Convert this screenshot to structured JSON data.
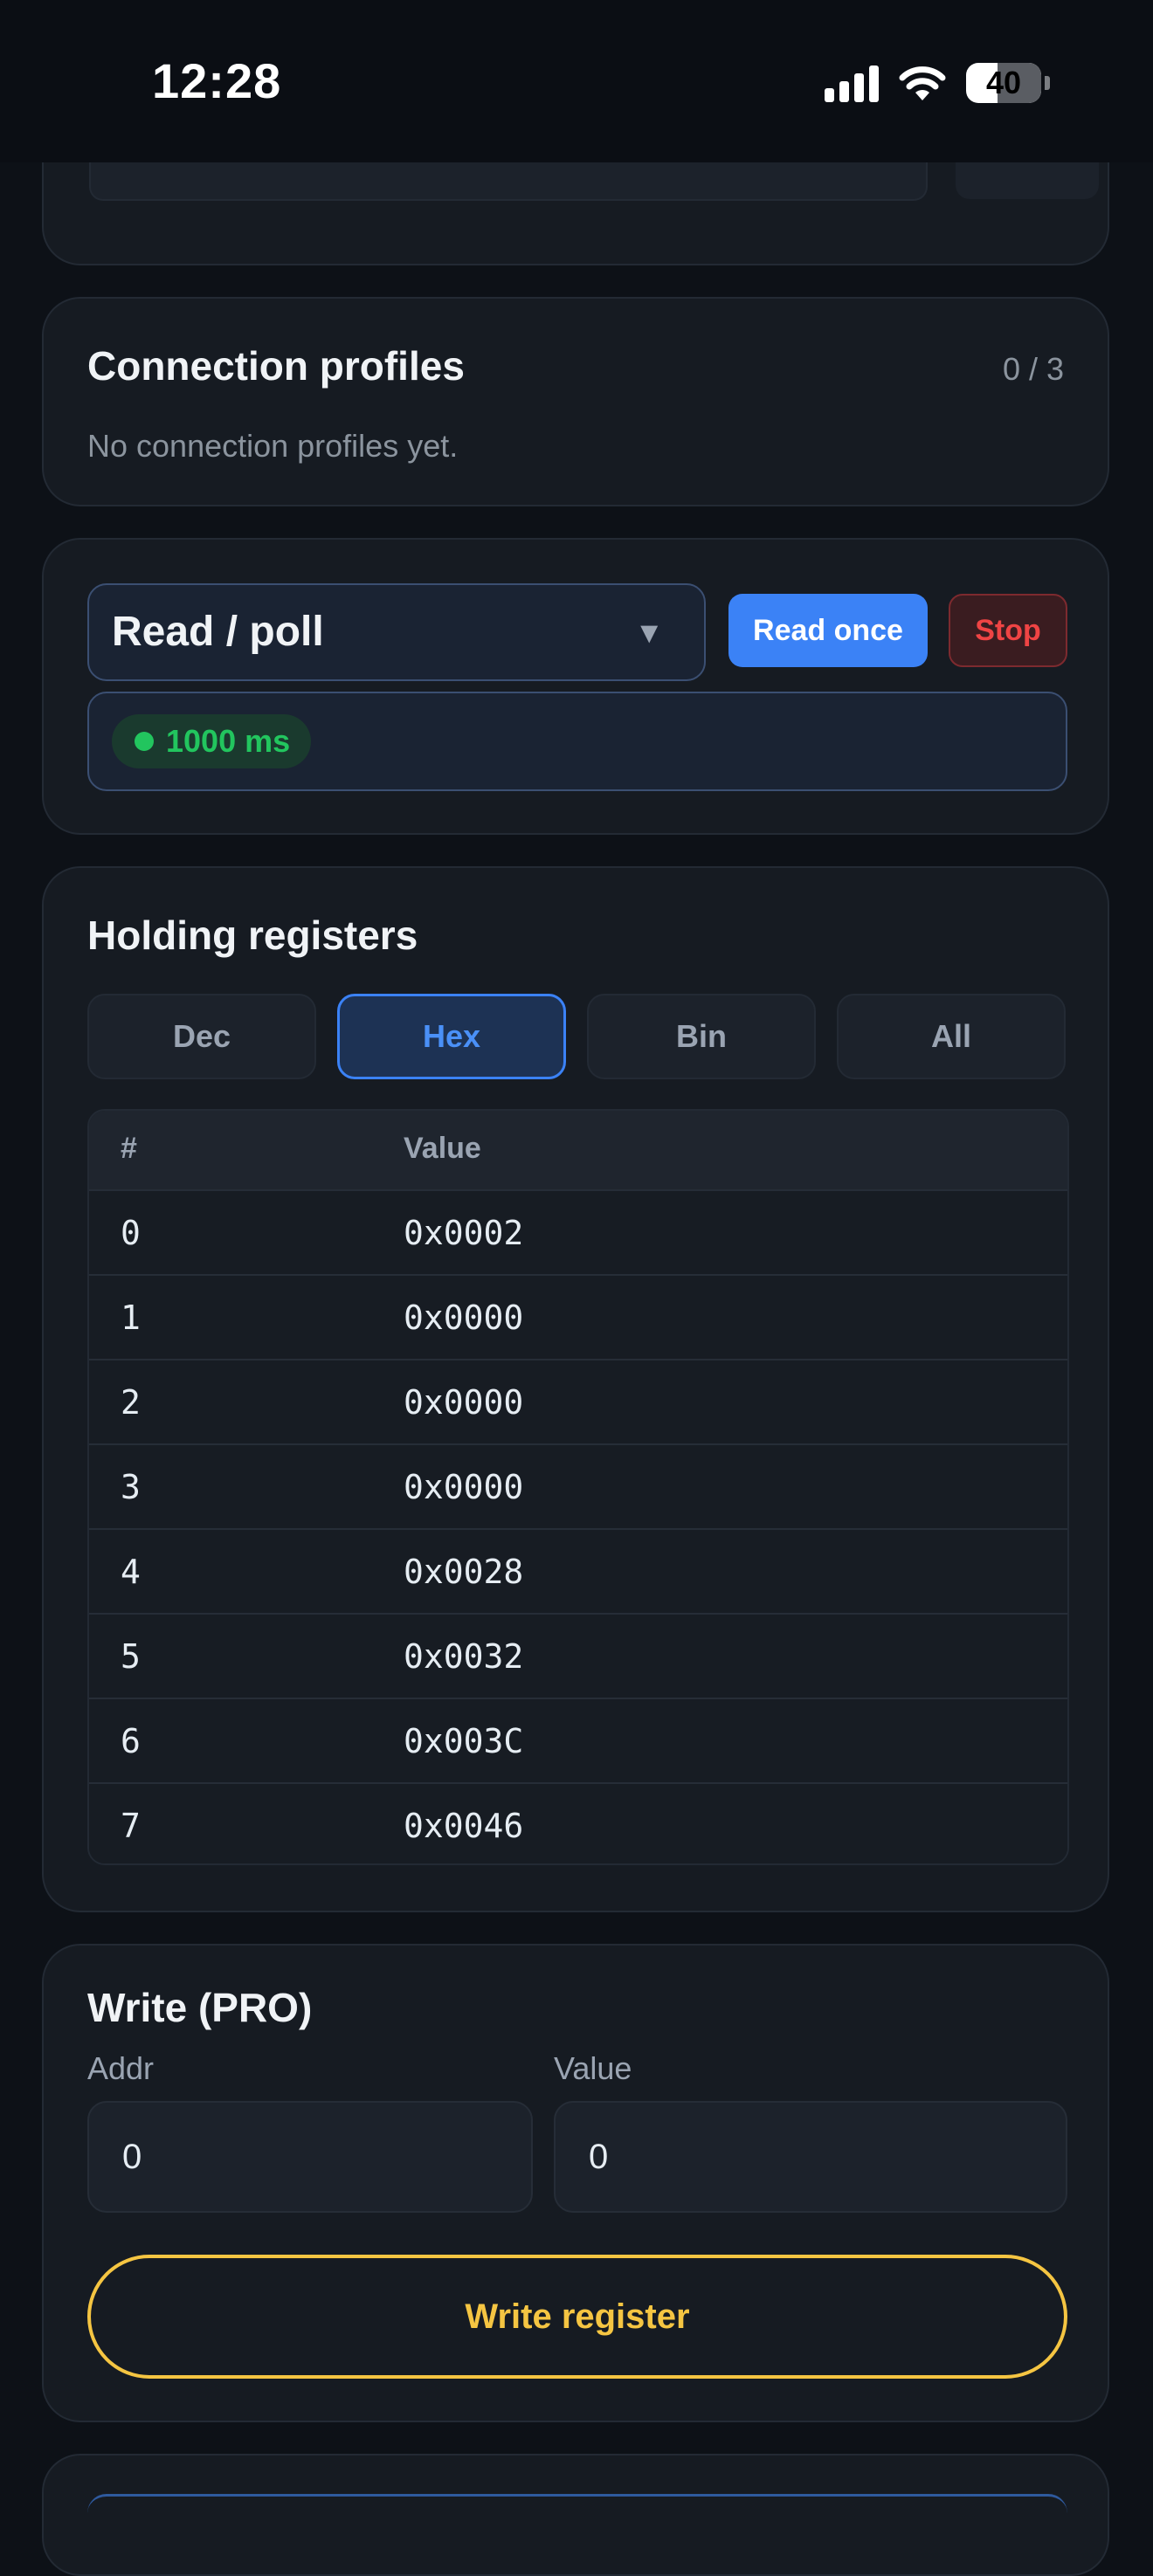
{
  "status_bar": {
    "time": "12:28",
    "battery": "40"
  },
  "profiles": {
    "title": "Connection profiles",
    "count": "0 / 3",
    "empty_text": "No connection profiles yet."
  },
  "read": {
    "mode_label": "Read / poll",
    "read_once_label": "Read once",
    "stop_label": "Stop",
    "interval_label": "1000 ms"
  },
  "holding": {
    "title": "Holding registers",
    "formats": [
      "Dec",
      "Hex",
      "Bin",
      "All"
    ],
    "active_format": "Hex",
    "columns": [
      "#",
      "Value"
    ],
    "rows": [
      {
        "idx": "0",
        "value": "0x0002"
      },
      {
        "idx": "1",
        "value": "0x0000"
      },
      {
        "idx": "2",
        "value": "0x0000"
      },
      {
        "idx": "3",
        "value": "0x0000"
      },
      {
        "idx": "4",
        "value": "0x0028"
      },
      {
        "idx": "5",
        "value": "0x0032"
      },
      {
        "idx": "6",
        "value": "0x003C"
      },
      {
        "idx": "7",
        "value": "0x0046"
      }
    ]
  },
  "write": {
    "title": "Write (PRO)",
    "addr_label": "Addr",
    "addr_value": "0",
    "value_label": "Value",
    "value_value": "0",
    "button_label": "Write register"
  },
  "colors": {
    "accent": "#3b82f6",
    "stop": "#ef4444",
    "live": "#22c55e",
    "pro": "#f5c542"
  }
}
